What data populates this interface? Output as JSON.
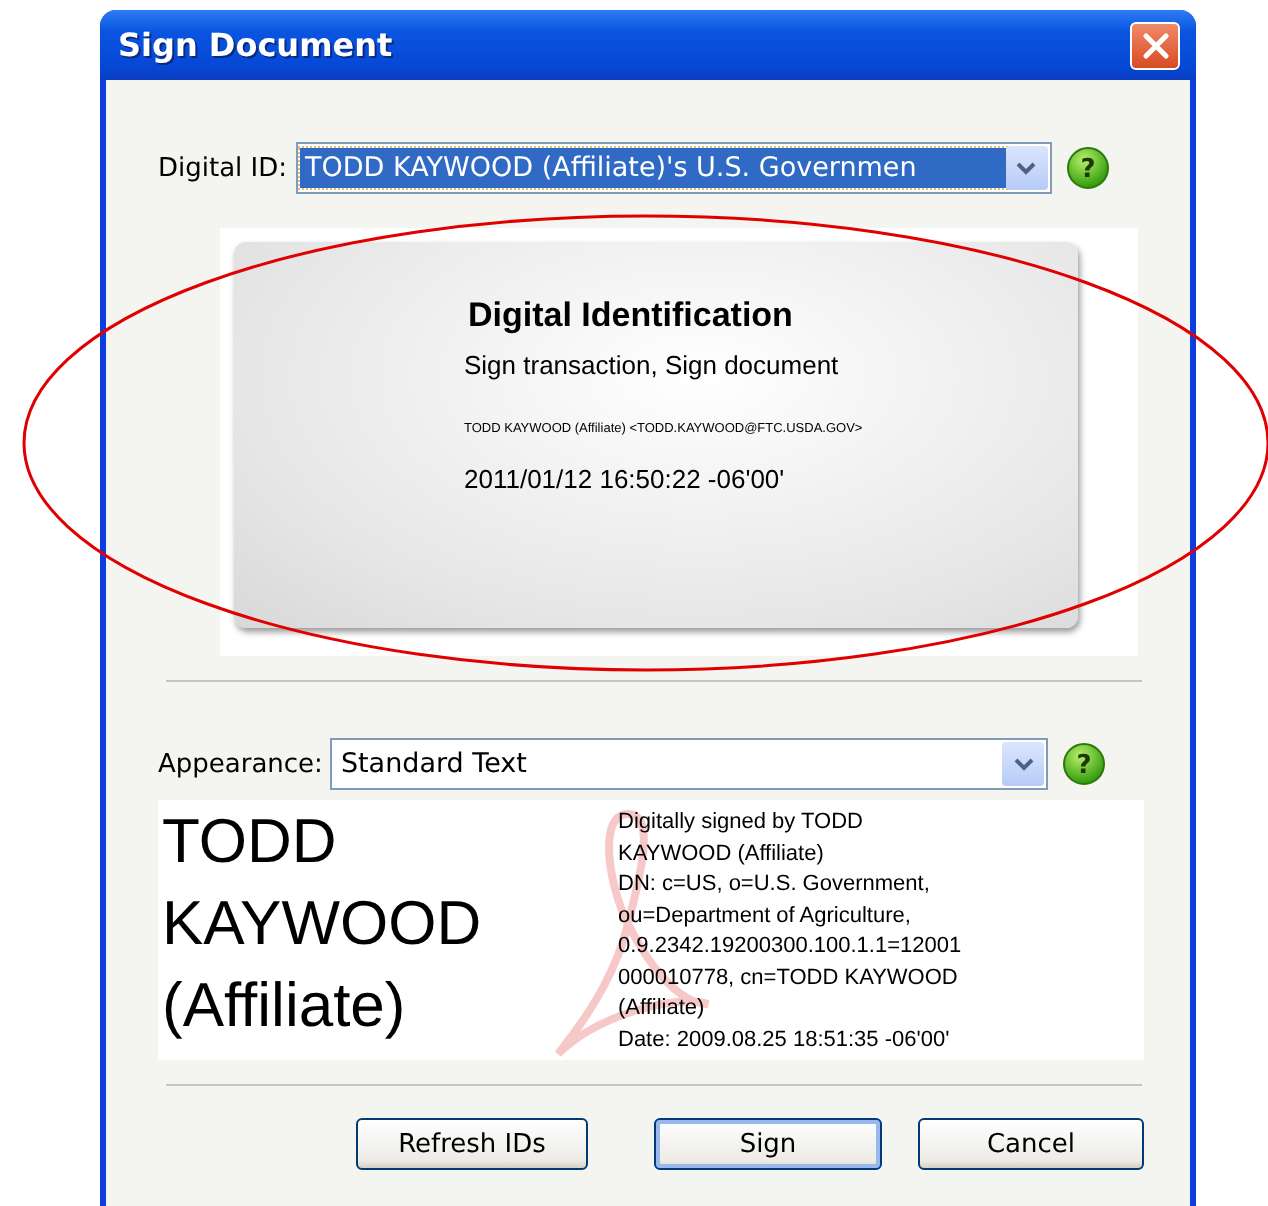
{
  "window": {
    "title": "Sign Document"
  },
  "digital_id": {
    "label": "Digital ID:",
    "value": "TODD KAYWOOD (Affiliate)'s U.S. Governmen",
    "selected": true,
    "help": "?"
  },
  "id_card": {
    "title": "Digital Identification",
    "usage": "Sign transaction, Sign document",
    "subject": "TODD KAYWOOD (Affiliate) <TODD.KAYWOOD@FTC.USDA.GOV>",
    "date": "2011/01/12 16:50:22 -06'00'"
  },
  "appearance": {
    "label": "Appearance:",
    "value": "Standard Text",
    "selected": false,
    "help": "?"
  },
  "preview": {
    "name_lines": [
      "TODD",
      "KAYWOOD",
      "(Affiliate)"
    ],
    "details": [
      "Digitally signed by TODD",
      "KAYWOOD (Affiliate)",
      "DN: c=US, o=U.S. Government,",
      "ou=Department of Agriculture,",
      "0.9.2342.19200300.100.1.1=12001",
      "000010778, cn=TODD KAYWOOD",
      "(Affiliate)",
      "Date: 2009.08.25 18:51:35 -06'00'"
    ]
  },
  "buttons": [
    {
      "label": "Refresh IDs",
      "default": false
    },
    {
      "label": "Sign",
      "default": true
    },
    {
      "label": "Cancel",
      "default": false
    }
  ],
  "annotation": {
    "kind": "ellipse"
  }
}
